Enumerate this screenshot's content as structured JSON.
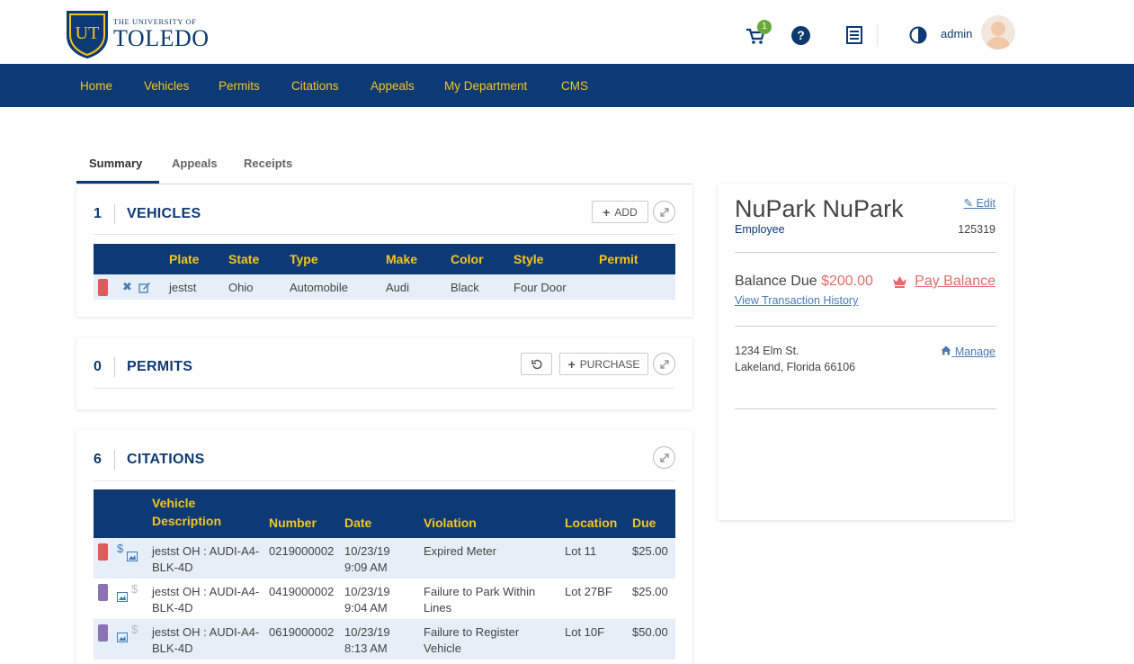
{
  "header": {
    "logo_small": "THE UNIVERSITY OF",
    "logo_big": "TOLEDO",
    "logo_monogram": "UT",
    "cart_count": "1",
    "help_glyph": "?",
    "user_name": "admin"
  },
  "nav": {
    "items": [
      "Home",
      "Vehicles",
      "Permits",
      "Citations",
      "Appeals",
      "My Department",
      "CMS"
    ]
  },
  "tabs": [
    "Summary",
    "Appeals",
    "Receipts"
  ],
  "vehicles": {
    "count": "1",
    "title": "VEHICLES",
    "add_label": "ADD",
    "columns": [
      "Plate",
      "State",
      "Type",
      "Make",
      "Color",
      "Style",
      "Permit"
    ],
    "rows": [
      {
        "plate": "jestst",
        "state": "Ohio",
        "type": "Automobile",
        "make": "Audi",
        "color": "Black",
        "style": "Four Door",
        "permit": "",
        "swatch": "#e05a5a"
      }
    ]
  },
  "permits": {
    "count": "0",
    "title": "PERMITS",
    "purchase_label": "PURCHASE"
  },
  "citations": {
    "count": "6",
    "title": "CITATIONS",
    "columns": [
      "Vehicle Description",
      "Number",
      "Date",
      "Violation",
      "Location",
      "Due"
    ],
    "rows": [
      {
        "vehicle": "jestst OH : AUDI-A4-BLK-4D",
        "number": "0219000002",
        "date": "10/23/19 9:09 AM",
        "violation": "Expired Meter",
        "location": "Lot 11",
        "due": "$25.00",
        "swatch": "#e05a5a",
        "dollar_color": "#3b7bc2"
      },
      {
        "vehicle": "jestst OH : AUDI-A4-BLK-4D",
        "number": "0419000002",
        "date": "10/23/19 9:04 AM",
        "violation": "Failure to Park Within Lines",
        "location": "Lot 27BF",
        "due": "$25.00",
        "swatch": "#8a73b5",
        "dollar_color": "#bbbbbb"
      },
      {
        "vehicle": "jestst OH : AUDI-A4-BLK-4D",
        "number": "0619000002",
        "date": "10/23/19 8:13 AM",
        "violation": "Failure to Register Vehicle",
        "location": "Lot 10F",
        "due": "$50.00",
        "swatch": "#8a73b5",
        "dollar_color": "#bbbbbb"
      }
    ]
  },
  "profile": {
    "name": "NuPark NuPark",
    "edit_label": "Edit",
    "role": "Employee",
    "id": "125319",
    "balance_label": "Balance Due",
    "balance_amount": "$200.00",
    "pay_label": "Pay Balance",
    "history_label": "View Transaction History",
    "address_line1": "1234 Elm St.",
    "address_line2": "Lakeland, Florida 66106",
    "manage_label": "Manage"
  },
  "colors": {
    "brand_navy": "#0d3a75",
    "brand_gold": "#f5c51c",
    "balance_red": "#e46b6b",
    "link_blue": "#4a7ab5"
  }
}
